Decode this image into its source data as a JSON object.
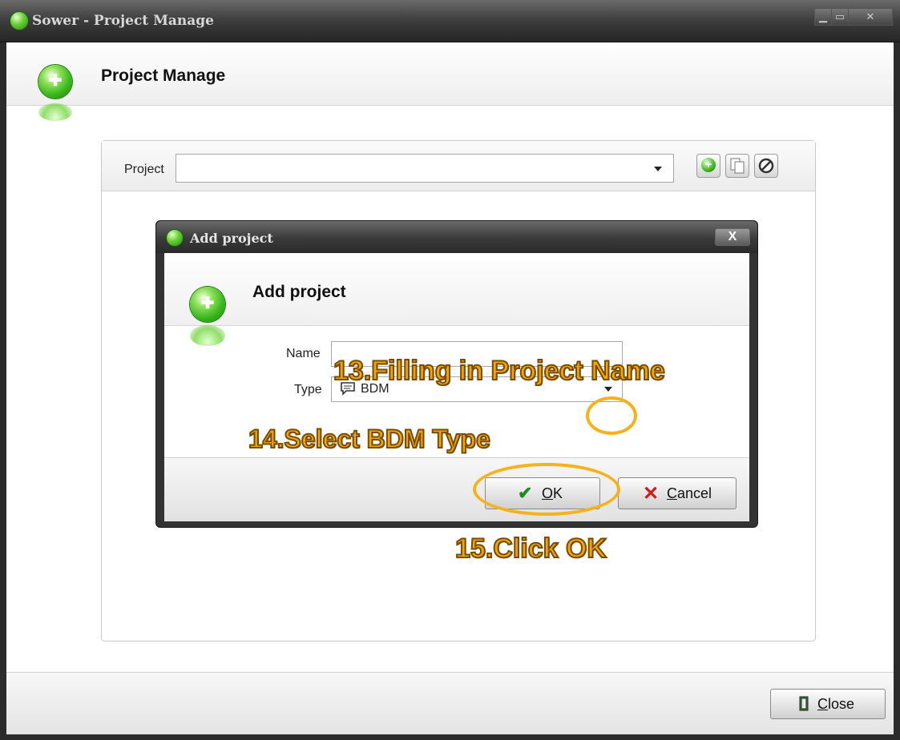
{
  "window": {
    "title": "Sower - Project Manage"
  },
  "header": {
    "title": "Project Manage"
  },
  "project": {
    "label": "Project",
    "value": ""
  },
  "footer": {
    "close_label": "Close",
    "close_mnemonic": "C",
    "close_rest": "lose"
  },
  "dialog": {
    "title": "Add project",
    "header_title": "Add project",
    "name_label": "Name",
    "name_value": "",
    "type_label": "Type",
    "type_value": "BDM",
    "ok_label": "OK",
    "ok_mnemonic": "O",
    "ok_rest": "K",
    "cancel_label": "Cancel",
    "cancel_mnemonic": "C",
    "cancel_rest": "ancel"
  },
  "annotations": {
    "step13": "13.Filling in Project Name",
    "step14": "14.Select BDM Type",
    "step15": "15.Click OK"
  },
  "colors": {
    "annotation_text": "#f0a800",
    "annotation_circle": "#f5b21a",
    "titlebar": "#3c3c3c"
  },
  "icons": [
    "app-orb-icon",
    "add-icon",
    "copy-icon",
    "delete-icon",
    "checkmark-icon",
    "cross-icon",
    "door-icon",
    "chat-bubble-icon"
  ]
}
